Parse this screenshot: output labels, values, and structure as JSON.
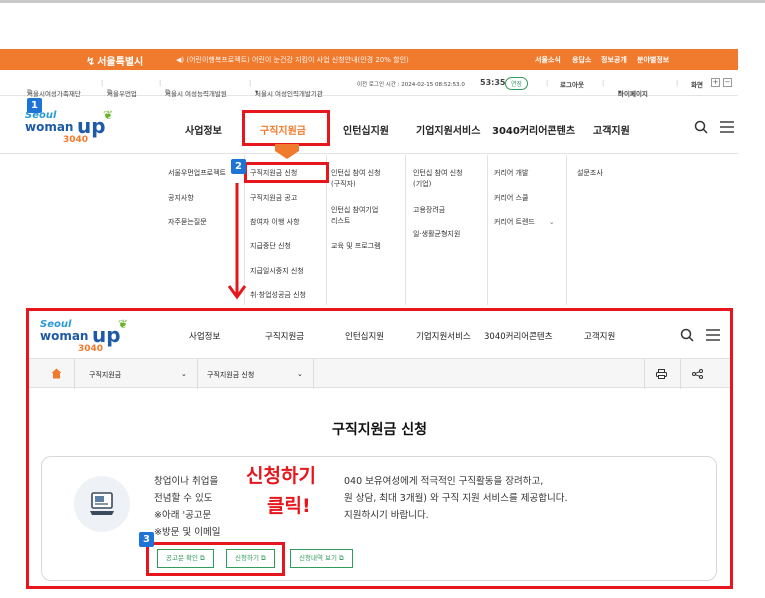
{
  "gov_bar": {
    "logo": "서울특별시",
    "notice": "(어린이행복프로젝트) 어린이 눈건강 지킴이 사업 신청안내(안경 20% 할인)",
    "links": [
      "서울소식",
      "응답소",
      "정보공개",
      "분야별정보"
    ]
  },
  "util_bar": {
    "sites": [
      "서울시여성가족재단",
      "서울우먼업",
      "서울시 여성능력개발원",
      "서울시 여성인력개발기관"
    ],
    "last_login_label": "이전 로그인 시간 : 2024-02-15 08:52:53.0",
    "timer": "53:35",
    "extend": "연장",
    "logout": "로그아웃",
    "mypage": "마이페이지",
    "screen": "화면",
    "zoom_in": "+",
    "zoom_out": "−"
  },
  "logo": {
    "seoul": "Seoul",
    "woman": "woman",
    "up": "up",
    "num": "3040"
  },
  "nav": [
    "사업정보",
    "구직지원금",
    "인턴십지원",
    "기업지원서비스",
    "3040커리어콘텐츠",
    "고객지원"
  ],
  "mega": {
    "col1": [
      "서울우먼업프로젝트",
      "공지사항",
      "자주묻는질문"
    ],
    "col2": [
      "구직지원금 신청",
      "구직지원금 공고",
      "참여자 이행 사항",
      "지급중단 신청",
      "지급일시중지 신청",
      "취·창업성공금 신청"
    ],
    "col3": [
      "인턴십 참여 신청",
      "(구직자)",
      "인턴십 참여기업",
      "리스트",
      "교육 및 프로그램"
    ],
    "col4": [
      "인턴십 참여 신청",
      "(기업)",
      "고용장려금",
      "일·생활균형지원"
    ],
    "col5": [
      "커리어 개발",
      "커리어 스쿨",
      "커리어 트렌드"
    ],
    "col6": [
      "설문조사"
    ]
  },
  "badges": [
    "1",
    "2",
    "3"
  ],
  "breadcrumb": {
    "level1": "구직지원금",
    "level2": "구직지원금 신청"
  },
  "page_title": "구직지원금 신청",
  "info_lines": [
    "창업이나 취업을",
    "040 보유여성에게 적극적인 구직활동을 장려하고,",
    "전념할 수 있도",
    "원 상담, 최대 3개월) 와 구직 지원 서비스를 제공합니다.",
    "※아래 '공고문",
    "지원하시기 바랍니다.",
    "※방문 및 이메일"
  ],
  "buttons": {
    "notice": "공고문 확인",
    "apply": "신청하기",
    "history": "신청내역 보기"
  },
  "overlay": {
    "line1": "신청하기",
    "line2": "클릭!"
  },
  "colors": {
    "orange": "#f07a2e",
    "red": "#e6161c",
    "green": "#2f9b5c",
    "blue": "#1e73d6",
    "navy": "#1e5aa8"
  }
}
